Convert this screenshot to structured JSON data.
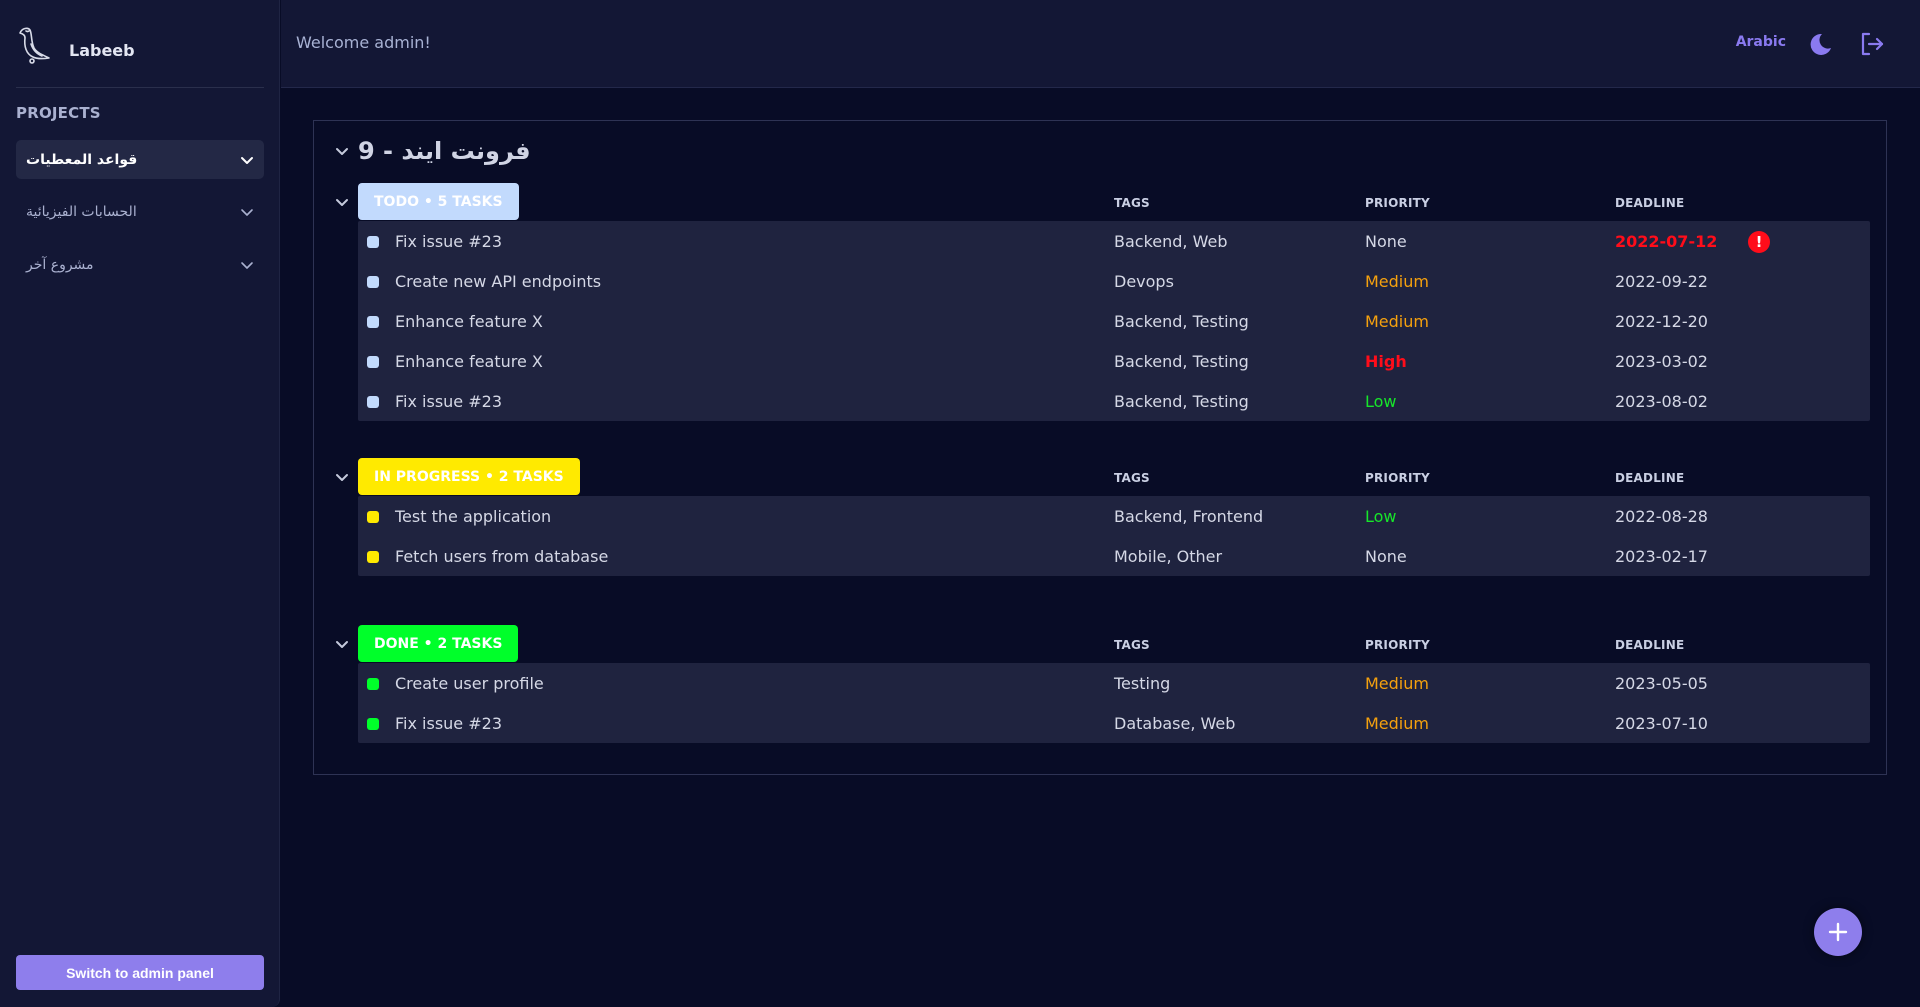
{
  "app": {
    "name": "Labeeb"
  },
  "sidebar": {
    "section_label": "PROJECTS",
    "projects": [
      {
        "name": "قواعد المعطيات",
        "active": true
      },
      {
        "name": "الحسابات الفيزيائية",
        "active": false
      },
      {
        "name": "مشروع آخر",
        "active": false
      }
    ],
    "admin_button": "Switch to admin panel"
  },
  "header": {
    "welcome": "Welcome admin!",
    "language_toggle": "Arabic",
    "theme_icon": "moon-icon",
    "logout_icon": "logout-icon"
  },
  "board": {
    "title": "فرونت ايند - 9",
    "columns": {
      "tags": "TAGS",
      "priority": "PRIORITY",
      "deadline": "DEADLINE"
    },
    "groups": [
      {
        "label": "TODO • 5 TASKS",
        "color": "#c2dafd",
        "tasks": [
          {
            "title": "Fix issue #23",
            "tags": "Backend, Web",
            "priority": "None",
            "deadline": "2022-07-12",
            "overdue": true
          },
          {
            "title": "Create new API endpoints",
            "tags": "Devops",
            "priority": "Medium",
            "deadline": "2022-09-22",
            "overdue": false
          },
          {
            "title": "Enhance feature X",
            "tags": "Backend, Testing",
            "priority": "Medium",
            "deadline": "2022-12-20",
            "overdue": false
          },
          {
            "title": "Enhance feature X",
            "tags": "Backend, Testing",
            "priority": "High",
            "deadline": "2023-03-02",
            "overdue": false
          },
          {
            "title": "Fix issue #23",
            "tags": "Backend, Testing",
            "priority": "Low",
            "deadline": "2023-08-02",
            "overdue": false
          }
        ]
      },
      {
        "label": "IN PROGRESS • 2 TASKS",
        "color": "#ffea00",
        "tasks": [
          {
            "title": "Test the application",
            "tags": "Backend, Frontend",
            "priority": "Low",
            "deadline": "2022-08-28",
            "overdue": false
          },
          {
            "title": "Fetch users from database",
            "tags": "Mobile, Other",
            "priority": "None",
            "deadline": "2023-02-17",
            "overdue": false
          }
        ]
      },
      {
        "label": "DONE • 2 TASKS",
        "color": "#00ff2a",
        "tasks": [
          {
            "title": "Create user profile",
            "tags": "Testing",
            "priority": "Medium",
            "deadline": "2023-05-05",
            "overdue": false
          },
          {
            "title": "Fix issue #23",
            "tags": "Database, Web",
            "priority": "Medium",
            "deadline": "2023-07-10",
            "overdue": false
          }
        ]
      }
    ]
  },
  "priority_colors": {
    "None": "#d5d8e6",
    "Low": "#17e62a",
    "Medium": "#f5a10e",
    "High": "#ff0d1a"
  },
  "accent_color": "#8e7eec",
  "fab": {
    "icon": "plus-icon"
  }
}
